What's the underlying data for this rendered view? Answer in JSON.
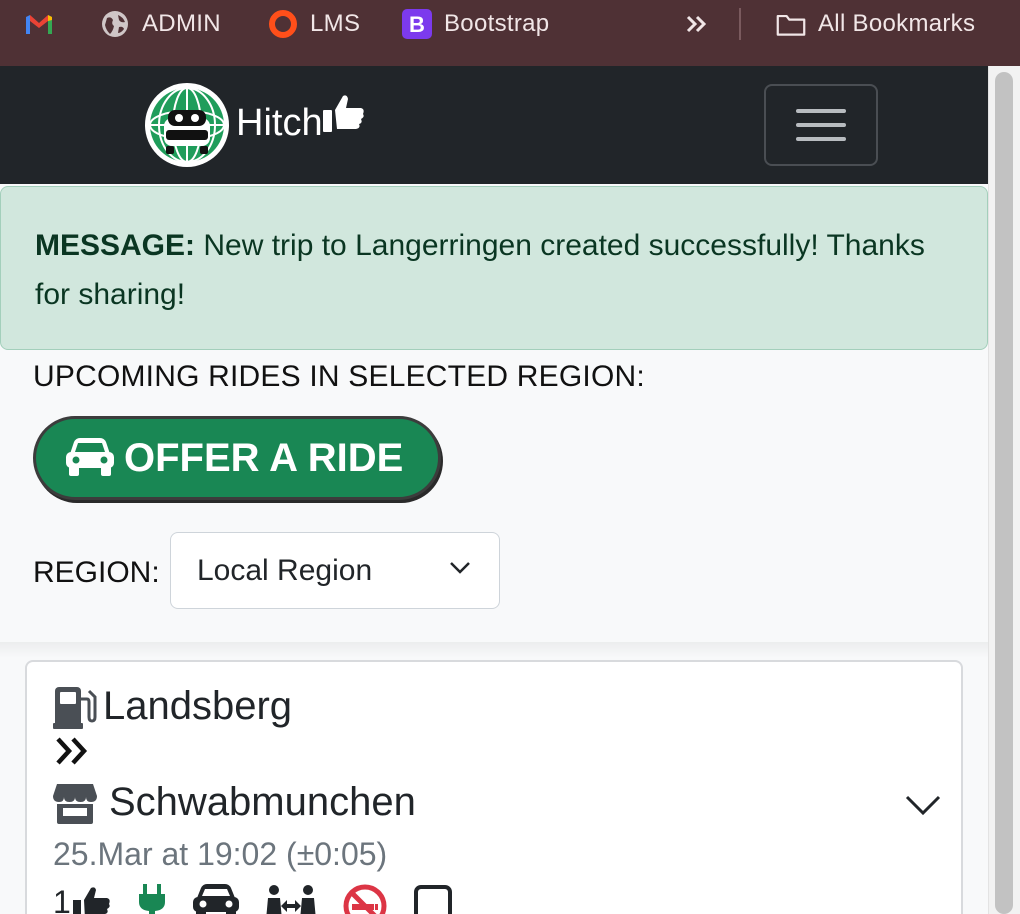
{
  "browser": {
    "bookmarks": [
      {
        "label": "",
        "icon": "gmail-icon"
      },
      {
        "label": "ADMIN",
        "icon": "globe-icon"
      },
      {
        "label": "LMS",
        "icon": "ring-icon"
      },
      {
        "label": "Bootstrap",
        "icon": "bootstrap-icon"
      }
    ],
    "more_icon": "chevrons-right-icon",
    "all_bookmarks_label": "All Bookmarks"
  },
  "navbar": {
    "brand_text": "Hitch",
    "toggler_icon": "hamburger-icon"
  },
  "alert": {
    "prefix": "MESSAGE:",
    "message": " New trip to Langerringen created successfully! Thanks for sharing!",
    "color_bg": "#d1e7dd",
    "color_text": "#0a3622"
  },
  "main": {
    "heading": "UPCOMING RIDES IN SELECTED REGION:",
    "offer_button_label": "OFFER A RIDE",
    "offer_button_color": "#198754",
    "region_label": "REGION:",
    "region_selected": "Local Region"
  },
  "rides": [
    {
      "from": "Landsberg",
      "from_icon": "gas-pump-icon",
      "to": "Schwabmunchen",
      "to_icon": "store-icon",
      "datetime": "25.Mar at 19:02 (±0:05)",
      "seats": "1",
      "features": [
        "thumbs-up-icon",
        "ev-plug-icon",
        "car-icon",
        "people-arrows-icon",
        "no-smoking-icon",
        "square-icon"
      ]
    }
  ]
}
